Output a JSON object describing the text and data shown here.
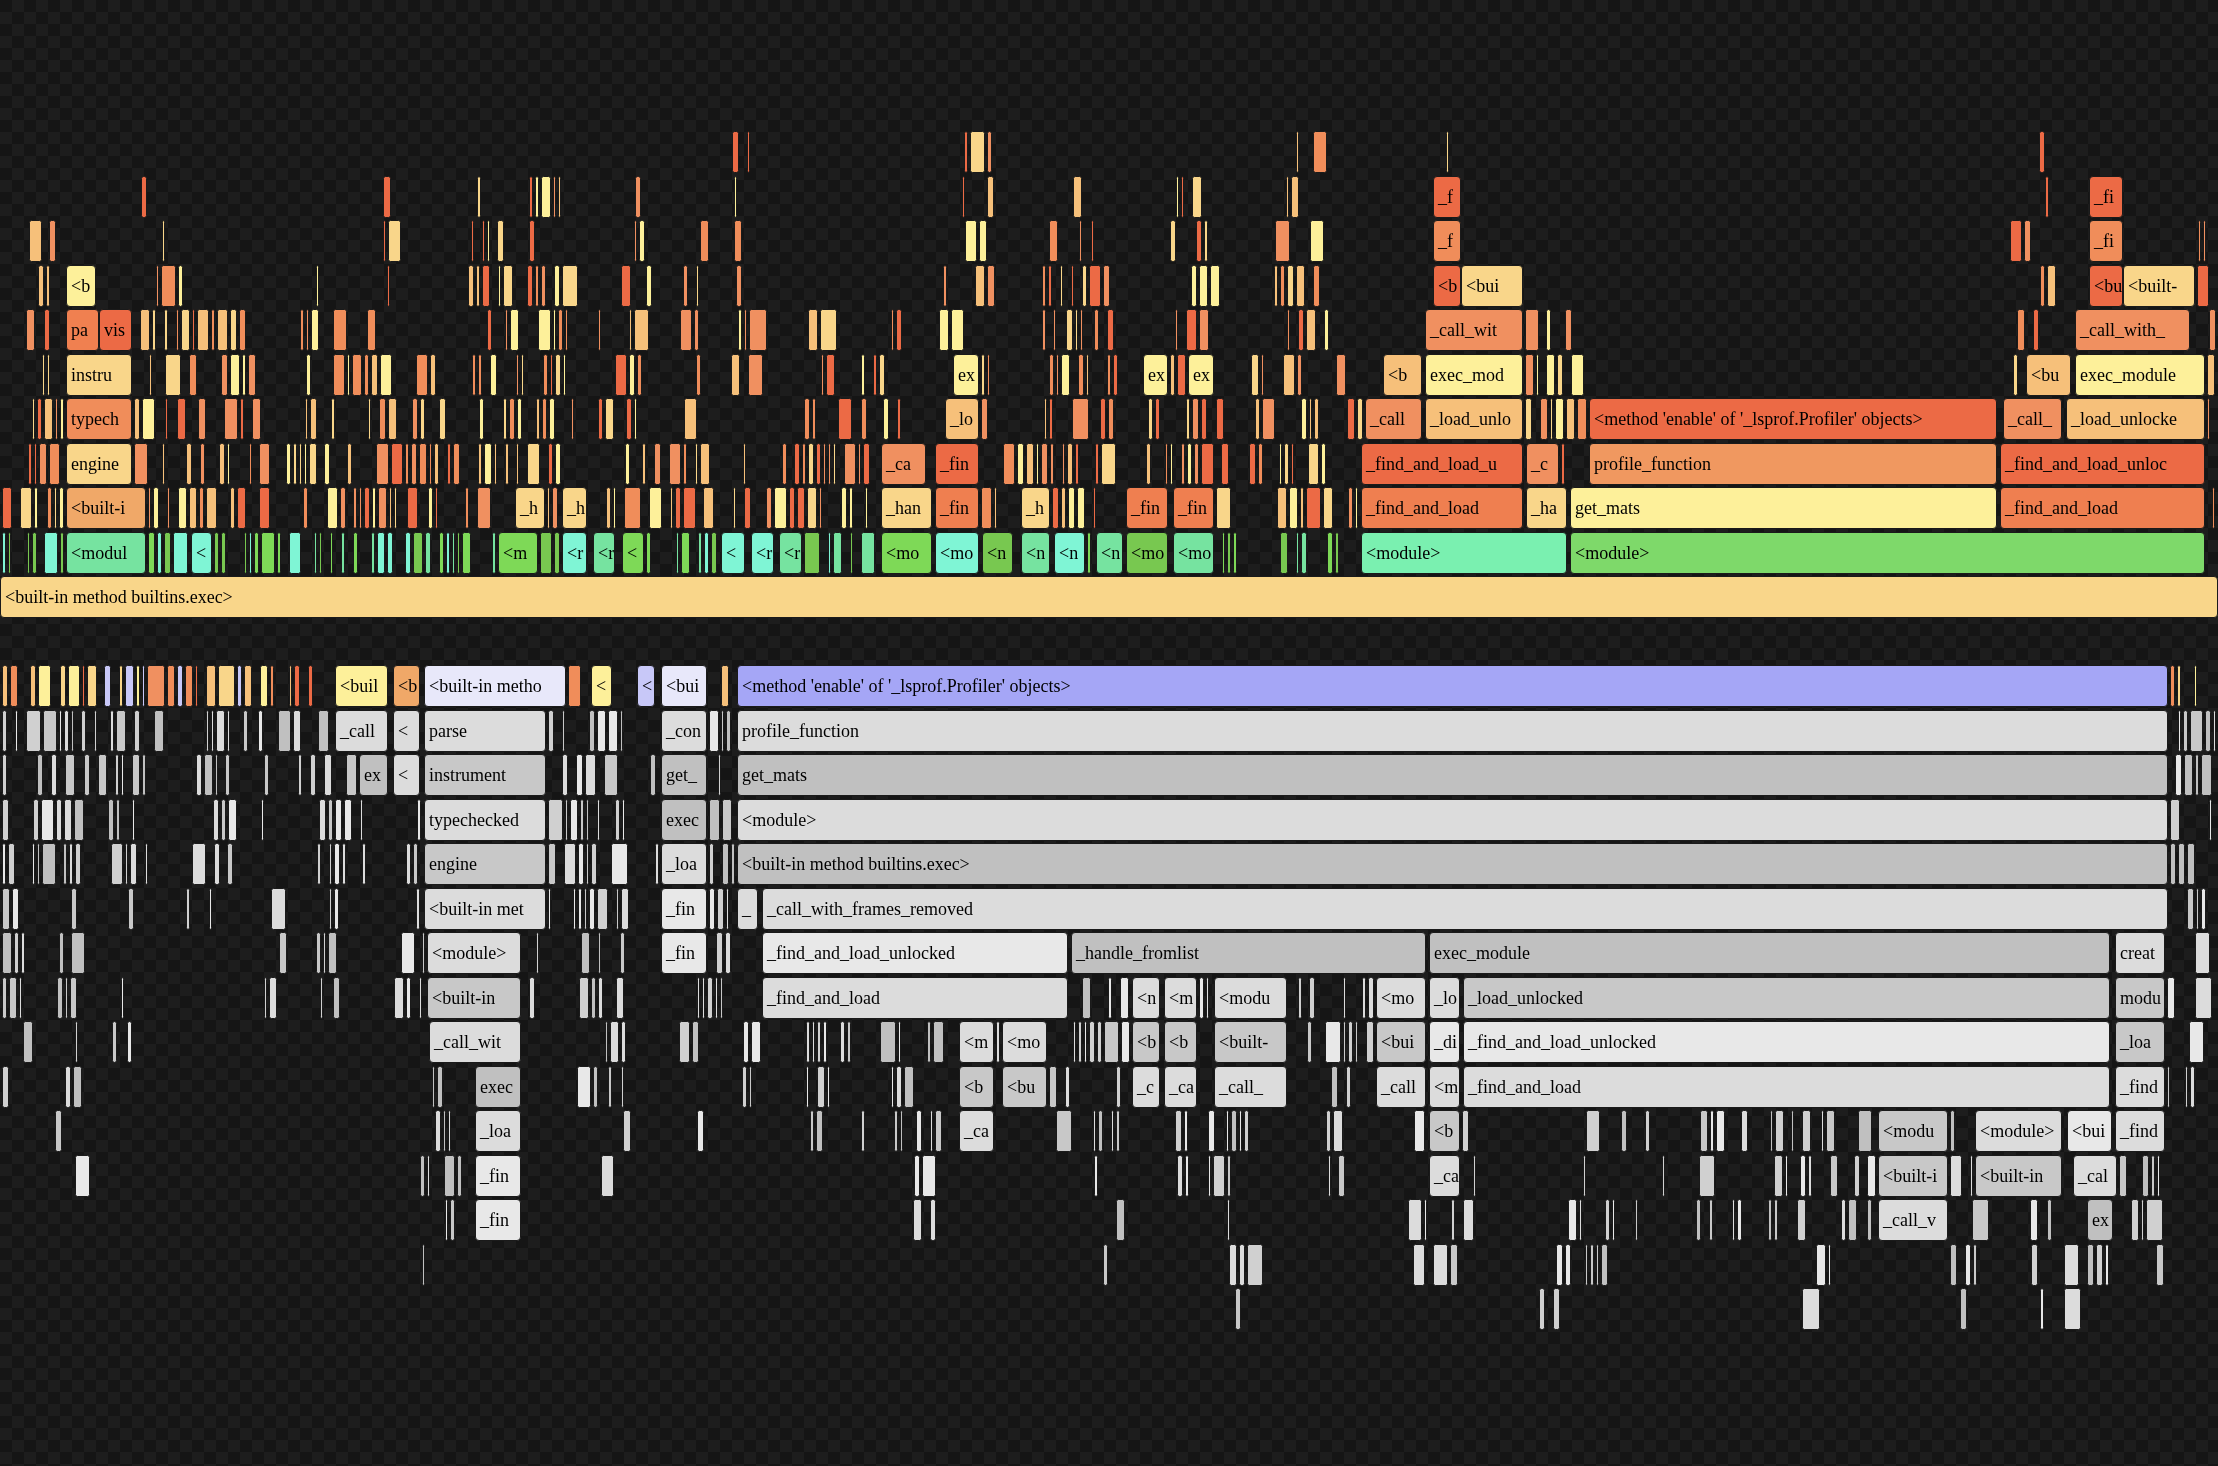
{
  "upper_flame": {
    "frames": [
      {
        "label": "_f",
        "color": "#ec6a45"
      },
      {
        "label": "_fi",
        "color": "#ec6a45"
      },
      {
        "label": "_f",
        "color": "#f08d5a"
      },
      {
        "label": "_fi",
        "color": "#f08d5a"
      },
      {
        "label": "<b",
        "color": "#fdf09a"
      },
      {
        "label": "<b",
        "color": "#ec6a45"
      },
      {
        "label": "<bui",
        "color": "#f9d68a"
      },
      {
        "label": "<bu",
        "color": "#ec6a45"
      },
      {
        "label": "<built-",
        "color": "#f9d68a"
      },
      {
        "label": "pa",
        "color": "#f08050"
      },
      {
        "label": "vis",
        "color": "#ec6a45"
      },
      {
        "label": "_call_wit",
        "color": "#f09060"
      },
      {
        "label": "_call_with_",
        "color": "#f09060"
      },
      {
        "label": "instru",
        "color": "#f9d68a"
      },
      {
        "label": "ex",
        "color": "#fdf09a"
      },
      {
        "label": "ex",
        "color": "#fdf09a"
      },
      {
        "label": "ex",
        "color": "#fdf09a"
      },
      {
        "label": "<b",
        "color": "#f6c07a"
      },
      {
        "label": "exec_mod",
        "color": "#fdf09a"
      },
      {
        "label": "<bu",
        "color": "#f6c07a"
      },
      {
        "label": "exec_module",
        "color": "#fdf09a"
      },
      {
        "label": "typech",
        "color": "#f08d5a"
      },
      {
        "label": "_lo",
        "color": "#f6c07a"
      },
      {
        "label": "_call",
        "color": "#f09060"
      },
      {
        "label": "_load_unlo",
        "color": "#f6c07a"
      },
      {
        "label": "<method 'enable' of '_lsprof.Profiler' objects>",
        "color": "#ec6a45"
      },
      {
        "label": "_call_",
        "color": "#f09060"
      },
      {
        "label": "_load_unlocke",
        "color": "#f6c07a"
      },
      {
        "label": "engine",
        "color": "#f9d68a"
      },
      {
        "label": "_ca",
        "color": "#f09060"
      },
      {
        "label": "_fin",
        "color": "#ec6a45"
      },
      {
        "label": "_find_and_load_u",
        "color": "#ec6a45"
      },
      {
        "label": "_c",
        "color": "#f09060"
      },
      {
        "label": "profile_function",
        "color": "#f09860"
      },
      {
        "label": "_find_and_load_unloc",
        "color": "#ec6a45"
      },
      {
        "label": "<built-i",
        "color": "#f0a868"
      },
      {
        "label": "_h",
        "color": "#f9d68a"
      },
      {
        "label": "_h",
        "color": "#f9d68a"
      },
      {
        "label": "_han",
        "color": "#f9d68a"
      },
      {
        "label": "_fin",
        "color": "#ef7f50"
      },
      {
        "label": "_h",
        "color": "#f9d68a"
      },
      {
        "label": "_fin",
        "color": "#ef7f50"
      },
      {
        "label": "_fin",
        "color": "#ef7f50"
      },
      {
        "label": "_find_and_load",
        "color": "#ef7f50"
      },
      {
        "label": "_ha",
        "color": "#f9d68a"
      },
      {
        "label": "get_mats",
        "color": "#fdf09a"
      },
      {
        "label": "_find_and_load",
        "color": "#ef7f50"
      },
      {
        "label": "<modul",
        "color": "#76e3a0"
      },
      {
        "label": "<",
        "color": "#7ff5d5"
      },
      {
        "label": "<m",
        "color": "#7ed957"
      },
      {
        "label": "<r",
        "color": "#7ff5d5"
      },
      {
        "label": "<r",
        "color": "#76e3a0"
      },
      {
        "label": "<",
        "color": "#7ed957"
      },
      {
        "label": "<",
        "color": "#7ff5d5"
      },
      {
        "label": "<r",
        "color": "#7ff5d5"
      },
      {
        "label": "<r",
        "color": "#76e3a0"
      },
      {
        "label": "<mo",
        "color": "#7ed957"
      },
      {
        "label": "<mo",
        "color": "#7ff5d5"
      },
      {
        "label": "<n",
        "color": "#78c850"
      },
      {
        "label": "<n",
        "color": "#76e3a0"
      },
      {
        "label": "<n",
        "color": "#7ff5d5"
      },
      {
        "label": "<n",
        "color": "#76e3a0"
      },
      {
        "label": "<mo",
        "color": "#78c850"
      },
      {
        "label": "<mo",
        "color": "#76e3a0"
      },
      {
        "label": "<module>",
        "color": "#7af0b0"
      },
      {
        "label": "<module>",
        "color": "#7ed96a"
      },
      {
        "label": "<built-in method builtins.exec>",
        "color": "#f9d68a"
      }
    ]
  },
  "lower_icicle": {
    "frames": [
      {
        "label": "<buil",
        "color": "#fdf09a"
      },
      {
        "label": "<b",
        "color": "#f0a868"
      },
      {
        "label": "<built-in metho",
        "color": "#e8e8fa"
      },
      {
        "label": "<",
        "color": "#fdf09a"
      },
      {
        "label": "<",
        "color": "#c8c8f8"
      },
      {
        "label": "<bui",
        "color": "#e8e8fa"
      },
      {
        "label": "<method 'enable' of '_lsprof.Profiler' objects>",
        "color": "#a5a6f6"
      },
      {
        "label": "_call",
        "color": "#dcdcdc"
      },
      {
        "label": "<",
        "color": "#dcdcdc"
      },
      {
        "label": "parse",
        "color": "#dcdcdc"
      },
      {
        "label": "_con",
        "color": "#dcdcdc"
      },
      {
        "label": "profile_function",
        "color": "#dcdcdc"
      },
      {
        "label": "ex",
        "color": "#c0c0c0"
      },
      {
        "label": "<",
        "color": "#dcdcdc"
      },
      {
        "label": "instrument",
        "color": "#c8c8c8"
      },
      {
        "label": "get_",
        "color": "#c0c0c0"
      },
      {
        "label": "get_mats",
        "color": "#c0c0c0"
      },
      {
        "label": "typechecked",
        "color": "#dcdcdc"
      },
      {
        "label": "exec",
        "color": "#c0c0c0"
      },
      {
        "label": "<module>",
        "color": "#dcdcdc"
      },
      {
        "label": "engine",
        "color": "#c8c8c8"
      },
      {
        "label": "_loa",
        "color": "#dcdcdc"
      },
      {
        "label": "<built-in method builtins.exec>",
        "color": "#c0c0c0"
      },
      {
        "label": "<built-in met",
        "color": "#dcdcdc"
      },
      {
        "label": "_fin",
        "color": "#e8e8e8"
      },
      {
        "label": "_",
        "color": "#dcdcdc"
      },
      {
        "label": "_call_with_frames_removed",
        "color": "#dcdcdc"
      },
      {
        "label": "<module>",
        "color": "#dcdcdc"
      },
      {
        "label": "_fin",
        "color": "#e8e8e8"
      },
      {
        "label": "_find_and_load_unlocked",
        "color": "#e8e8e8"
      },
      {
        "label": "_handle_fromlist",
        "color": "#c0c0c0"
      },
      {
        "label": "exec_module",
        "color": "#c0c0c0"
      },
      {
        "label": "creat",
        "color": "#dcdcdc"
      },
      {
        "label": "<built-in",
        "color": "#c8c8c8"
      },
      {
        "label": "_find_and_load",
        "color": "#dcdcdc"
      },
      {
        "label": "<n",
        "color": "#dcdcdc"
      },
      {
        "label": "<m",
        "color": "#dcdcdc"
      },
      {
        "label": "<modu",
        "color": "#dcdcdc"
      },
      {
        "label": "<mo",
        "color": "#dcdcdc"
      },
      {
        "label": "_lo",
        "color": "#dcdcdc"
      },
      {
        "label": "_load_unlocked",
        "color": "#c8c8c8"
      },
      {
        "label": "modu",
        "color": "#c8c8c8"
      },
      {
        "label": "_call_wit",
        "color": "#dcdcdc"
      },
      {
        "label": "<m",
        "color": "#dcdcdc"
      },
      {
        "label": "<mo",
        "color": "#dcdcdc"
      },
      {
        "label": "<b",
        "color": "#c8c8c8"
      },
      {
        "label": "<b",
        "color": "#c8c8c8"
      },
      {
        "label": "<built-",
        "color": "#c8c8c8"
      },
      {
        "label": "<bui",
        "color": "#c8c8c8"
      },
      {
        "label": "_di",
        "color": "#e8e8e8"
      },
      {
        "label": "_find_and_load_unlocked",
        "color": "#e8e8e8"
      },
      {
        "label": "_loa",
        "color": "#c8c8c8"
      },
      {
        "label": "exec",
        "color": "#c0c0c0"
      },
      {
        "label": "<b",
        "color": "#c8c8c8"
      },
      {
        "label": "<bu",
        "color": "#c8c8c8"
      },
      {
        "label": "_c",
        "color": "#dcdcdc"
      },
      {
        "label": "_ca",
        "color": "#dcdcdc"
      },
      {
        "label": "_call_",
        "color": "#dcdcdc"
      },
      {
        "label": "_call",
        "color": "#dcdcdc"
      },
      {
        "label": "<m",
        "color": "#dcdcdc"
      },
      {
        "label": "_find_and_load",
        "color": "#dcdcdc"
      },
      {
        "label": "_find",
        "color": "#dcdcdc"
      },
      {
        "label": "_loa",
        "color": "#dcdcdc"
      },
      {
        "label": "_ca",
        "color": "#dcdcdc"
      },
      {
        "label": "<b",
        "color": "#c8c8c8"
      },
      {
        "label": "<modu",
        "color": "#c8c8c8"
      },
      {
        "label": "<module>",
        "color": "#dcdcdc"
      },
      {
        "label": "<bui",
        "color": "#e8e8e8"
      },
      {
        "label": "_find",
        "color": "#dcdcdc"
      },
      {
        "label": "_fin",
        "color": "#e8e8e8"
      },
      {
        "label": "_ca",
        "color": "#dcdcdc"
      },
      {
        "label": "<built-i",
        "color": "#c8c8c8"
      },
      {
        "label": "<built-in",
        "color": "#c8c8c8"
      },
      {
        "label": "_cal",
        "color": "#dcdcdc"
      },
      {
        "label": "_fin",
        "color": "#e8e8e8"
      },
      {
        "label": "_call_v",
        "color": "#dcdcdc"
      },
      {
        "label": "ex",
        "color": "#c0c0c0"
      }
    ]
  }
}
